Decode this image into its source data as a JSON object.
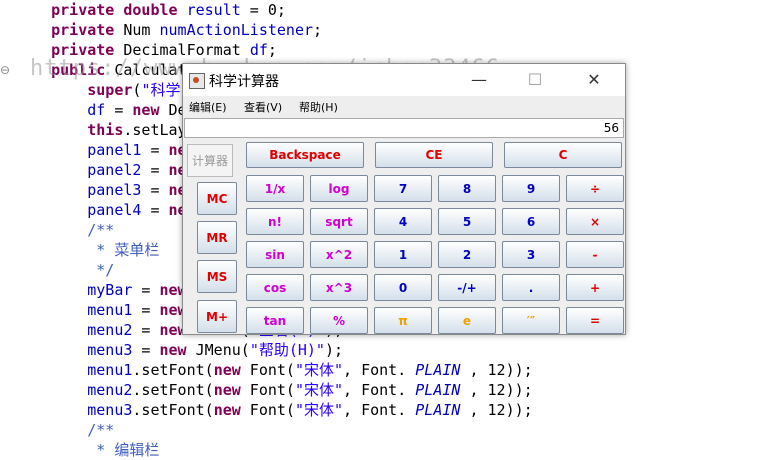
{
  "editor": {
    "gutter_marker": "⊖",
    "watermark": "https://www.huzhan.com/ishop33466",
    "lines": [
      [
        {
          "t": "    ",
          "c": ""
        },
        {
          "t": "private double",
          "c": "kw"
        },
        {
          "t": " ",
          "c": ""
        },
        {
          "t": "result",
          "c": "fld"
        },
        {
          "t": " = 0;",
          "c": ""
        }
      ],
      [
        {
          "t": "    ",
          "c": ""
        },
        {
          "t": "private",
          "c": "kw"
        },
        {
          "t": " Num ",
          "c": ""
        },
        {
          "t": "numActionListener",
          "c": "fld"
        },
        {
          "t": ";",
          "c": ""
        }
      ],
      [
        {
          "t": "    ",
          "c": ""
        },
        {
          "t": "private",
          "c": "kw"
        },
        {
          "t": " DecimalFormat ",
          "c": ""
        },
        {
          "t": "df",
          "c": "fld"
        },
        {
          "t": ";",
          "c": ""
        }
      ],
      [
        {
          "t": "    ",
          "c": ""
        },
        {
          "t": "public",
          "c": "kw"
        },
        {
          "t": " Calculato",
          "c": ""
        }
      ],
      [
        {
          "t": "        ",
          "c": ""
        },
        {
          "t": "super",
          "c": "kw"
        },
        {
          "t": "(",
          "c": ""
        },
        {
          "t": "\"科学",
          "c": "str"
        }
      ],
      [
        {
          "t": "        ",
          "c": ""
        },
        {
          "t": "df",
          "c": "fld"
        },
        {
          "t": " = ",
          "c": ""
        },
        {
          "t": "new",
          "c": "kw"
        },
        {
          "t": " De",
          "c": ""
        }
      ],
      [
        {
          "t": "        ",
          "c": ""
        },
        {
          "t": "this",
          "c": "kw"
        },
        {
          "t": ".setLay",
          "c": ""
        }
      ],
      [
        {
          "t": "        ",
          "c": ""
        },
        {
          "t": "panel1",
          "c": "fld"
        },
        {
          "t": " = ",
          "c": ""
        },
        {
          "t": "ne",
          "c": "kw"
        }
      ],
      [
        {
          "t": "        ",
          "c": ""
        },
        {
          "t": "panel2",
          "c": "fld"
        },
        {
          "t": " = ",
          "c": ""
        },
        {
          "t": "ne",
          "c": "kw"
        }
      ],
      [
        {
          "t": "        ",
          "c": ""
        },
        {
          "t": "panel3",
          "c": "fld"
        },
        {
          "t": " = ",
          "c": ""
        },
        {
          "t": "ne",
          "c": "kw"
        }
      ],
      [
        {
          "t": "        ",
          "c": ""
        },
        {
          "t": "panel4",
          "c": "fld"
        },
        {
          "t": " = ",
          "c": ""
        },
        {
          "t": "ne",
          "c": "kw"
        }
      ],
      [
        {
          "t": "        /**",
          "c": "cmt"
        }
      ],
      [
        {
          "t": "         * 菜单栏",
          "c": "cmt"
        }
      ],
      [
        {
          "t": "         */",
          "c": "cmt"
        }
      ],
      [
        {
          "t": "        ",
          "c": ""
        },
        {
          "t": "myBar",
          "c": "fld"
        },
        {
          "t": " = ",
          "c": ""
        },
        {
          "t": "new",
          "c": "kw"
        }
      ],
      [
        {
          "t": "        ",
          "c": ""
        },
        {
          "t": "menu1",
          "c": "fld"
        },
        {
          "t": " = ",
          "c": ""
        },
        {
          "t": "new",
          "c": "kw"
        }
      ],
      [
        {
          "t": "        ",
          "c": ""
        },
        {
          "t": "menu2",
          "c": "fld"
        },
        {
          "t": " = ",
          "c": ""
        },
        {
          "t": "new",
          "c": "kw"
        },
        {
          "t": " JMenu(",
          "c": ""
        },
        {
          "t": "\"查看(V)\"",
          "c": "str"
        },
        {
          "t": ");",
          "c": ""
        }
      ],
      [
        {
          "t": "        ",
          "c": ""
        },
        {
          "t": "menu3",
          "c": "fld"
        },
        {
          "t": " = ",
          "c": ""
        },
        {
          "t": "new",
          "c": "kw"
        },
        {
          "t": " JMenu(",
          "c": ""
        },
        {
          "t": "\"帮助(H)\"",
          "c": "str"
        },
        {
          "t": ");",
          "c": ""
        }
      ],
      [
        {
          "t": "        ",
          "c": ""
        },
        {
          "t": "menu1",
          "c": "fld"
        },
        {
          "t": ".setFont(",
          "c": ""
        },
        {
          "t": "new",
          "c": "kw"
        },
        {
          "t": " Font(",
          "c": ""
        },
        {
          "t": "\"宋体\"",
          "c": "str"
        },
        {
          "t": ", Font. ",
          "c": ""
        },
        {
          "t": "PLAIN",
          "c": "ital"
        },
        {
          "t": " , 12));",
          "c": ""
        }
      ],
      [
        {
          "t": "        ",
          "c": ""
        },
        {
          "t": "menu2",
          "c": "fld"
        },
        {
          "t": ".setFont(",
          "c": ""
        },
        {
          "t": "new",
          "c": "kw"
        },
        {
          "t": " Font(",
          "c": ""
        },
        {
          "t": "\"宋体\"",
          "c": "str"
        },
        {
          "t": ", Font. ",
          "c": ""
        },
        {
          "t": "PLAIN",
          "c": "ital"
        },
        {
          "t": " , 12));",
          "c": ""
        }
      ],
      [
        {
          "t": "        ",
          "c": ""
        },
        {
          "t": "menu3",
          "c": "fld"
        },
        {
          "t": ".setFont(",
          "c": ""
        },
        {
          "t": "new",
          "c": "kw"
        },
        {
          "t": " Font(",
          "c": ""
        },
        {
          "t": "\"宋体\"",
          "c": "str"
        },
        {
          "t": ", Font. ",
          "c": ""
        },
        {
          "t": "PLAIN",
          "c": "ital"
        },
        {
          "t": " , 12));",
          "c": ""
        }
      ],
      [
        {
          "t": "        /**",
          "c": "cmt"
        }
      ],
      [
        {
          "t": "         * 编辑栏",
          "c": "cmt"
        }
      ]
    ]
  },
  "window": {
    "title": "科学计算器",
    "minimize": "—",
    "maximize": "☐",
    "close": "✕",
    "menus": [
      "编辑(E)",
      "查看(V)",
      "帮助(H)"
    ],
    "display_value": "56",
    "panel_label": "计算器"
  },
  "memory_buttons": [
    {
      "label": "MC",
      "color": "#e00000"
    },
    {
      "label": "MR",
      "color": "#e00000"
    },
    {
      "label": "MS",
      "color": "#e00000"
    },
    {
      "label": "M+",
      "color": "#e00000"
    }
  ],
  "top_buttons": [
    {
      "label": "Backspace",
      "color": "#e00000"
    },
    {
      "label": "CE",
      "color": "#e00000"
    },
    {
      "label": "C",
      "color": "#e00000"
    }
  ],
  "grid_buttons": [
    [
      {
        "label": "1/x",
        "color": "#d000d0"
      },
      {
        "label": "log",
        "color": "#d000d0"
      },
      {
        "label": "7",
        "color": "#0000c0"
      },
      {
        "label": "8",
        "color": "#0000c0"
      },
      {
        "label": "9",
        "color": "#0000c0"
      },
      {
        "label": "÷",
        "color": "#e00000"
      }
    ],
    [
      {
        "label": "n!",
        "color": "#d000d0"
      },
      {
        "label": "sqrt",
        "color": "#d000d0"
      },
      {
        "label": "4",
        "color": "#0000c0"
      },
      {
        "label": "5",
        "color": "#0000c0"
      },
      {
        "label": "6",
        "color": "#0000c0"
      },
      {
        "label": "×",
        "color": "#e00000"
      }
    ],
    [
      {
        "label": "sin",
        "color": "#d000d0"
      },
      {
        "label": "x^2",
        "color": "#d000d0"
      },
      {
        "label": "1",
        "color": "#0000c0"
      },
      {
        "label": "2",
        "color": "#0000c0"
      },
      {
        "label": "3",
        "color": "#0000c0"
      },
      {
        "label": "-",
        "color": "#e00000"
      }
    ],
    [
      {
        "label": "cos",
        "color": "#d000d0"
      },
      {
        "label": "x^3",
        "color": "#d000d0"
      },
      {
        "label": "0",
        "color": "#0000c0"
      },
      {
        "label": "-/+",
        "color": "#0000c0"
      },
      {
        "label": ".",
        "color": "#0000c0"
      },
      {
        "label": "+",
        "color": "#e00000"
      }
    ],
    [
      {
        "label": "tan",
        "color": "#d000d0"
      },
      {
        "label": "%",
        "color": "#d000d0"
      },
      {
        "label": "π",
        "color": "#f0a000"
      },
      {
        "label": "e",
        "color": "#f0a000"
      },
      {
        "label": "′″",
        "color": "#f0a000"
      },
      {
        "label": "=",
        "color": "#e00000"
      }
    ]
  ]
}
